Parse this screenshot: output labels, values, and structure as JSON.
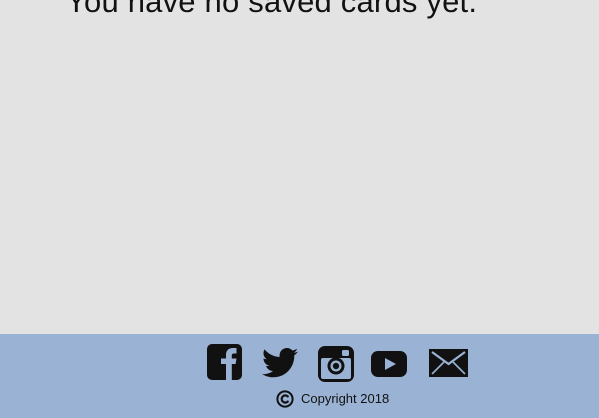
{
  "main": {
    "empty_message": "You have no saved cards yet."
  },
  "footer": {
    "background": "#9ab3d4",
    "social_icons": [
      "facebook-icon",
      "twitter-icon",
      "instagram-icon",
      "youtube-icon",
      "mail-icon"
    ],
    "copyright_icon": "copyright-icon",
    "copyright_text": "Copyright 2018"
  },
  "colors": {
    "page_background": "#e3e3e3",
    "icon_color": "#111111",
    "text_color": "#111111"
  }
}
